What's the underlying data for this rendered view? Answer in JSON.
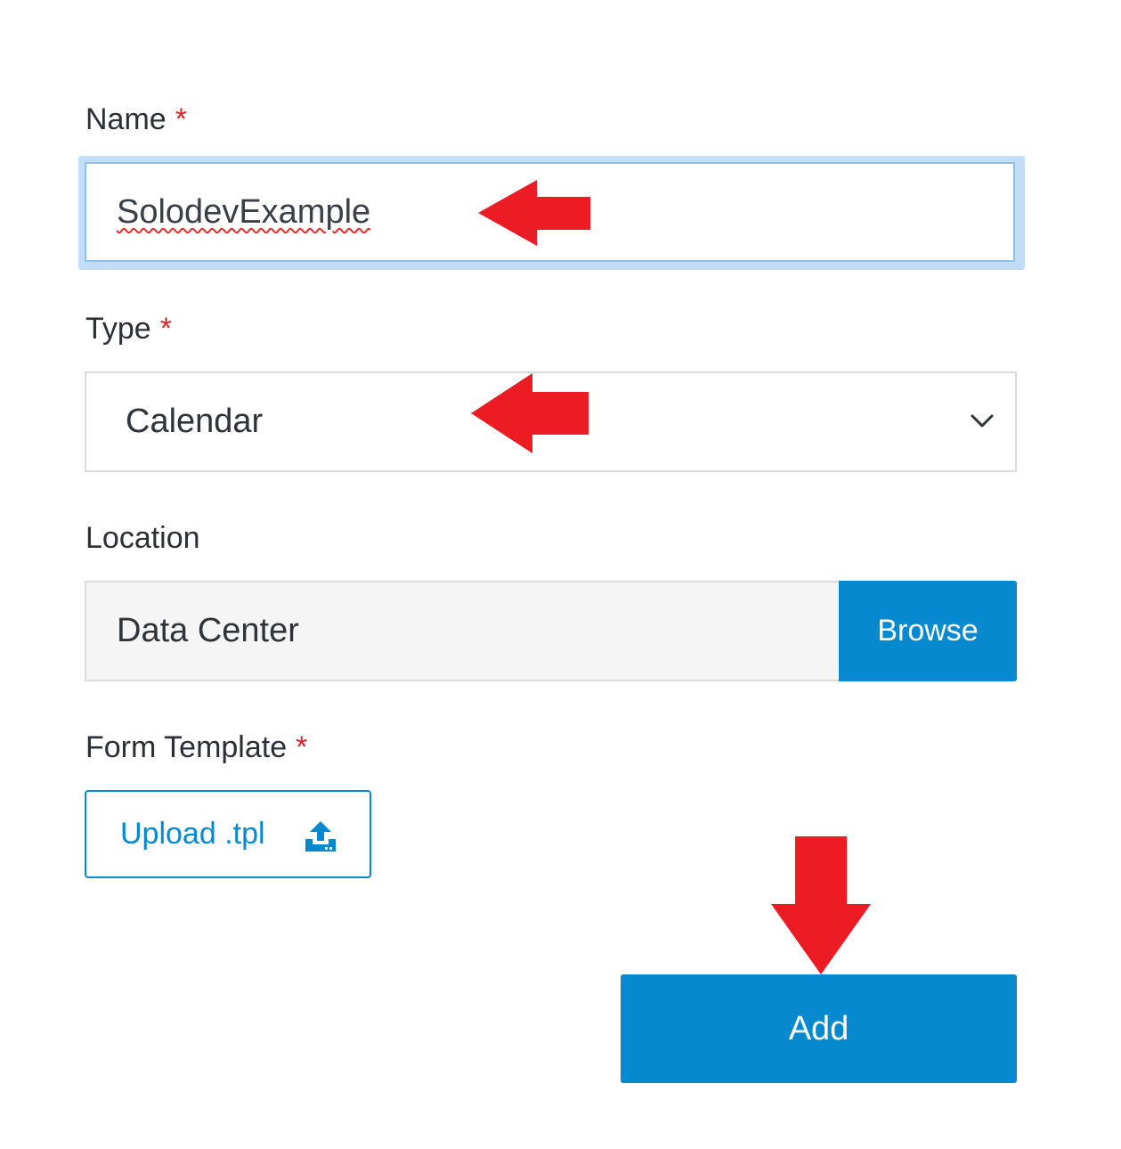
{
  "form": {
    "name": {
      "label": "Name",
      "required_mark": "*",
      "value": "SolodevExample"
    },
    "type": {
      "label": "Type",
      "required_mark": "*",
      "selected": "Calendar"
    },
    "location": {
      "label": "Location",
      "value": "Data Center",
      "browse_label": "Browse"
    },
    "form_template": {
      "label": "Form Template",
      "required_mark": "*",
      "upload_label": "Upload .tpl"
    },
    "add_label": "Add"
  },
  "icons": {
    "select": "chevron-down-icon",
    "upload": "upload-icon",
    "annotations": "red-arrow-icon"
  },
  "colors": {
    "accent": "#0789cf",
    "required": "#d9262b",
    "focus_ring": "#c3ddf7",
    "annotation_arrow": "#ec1c24"
  }
}
